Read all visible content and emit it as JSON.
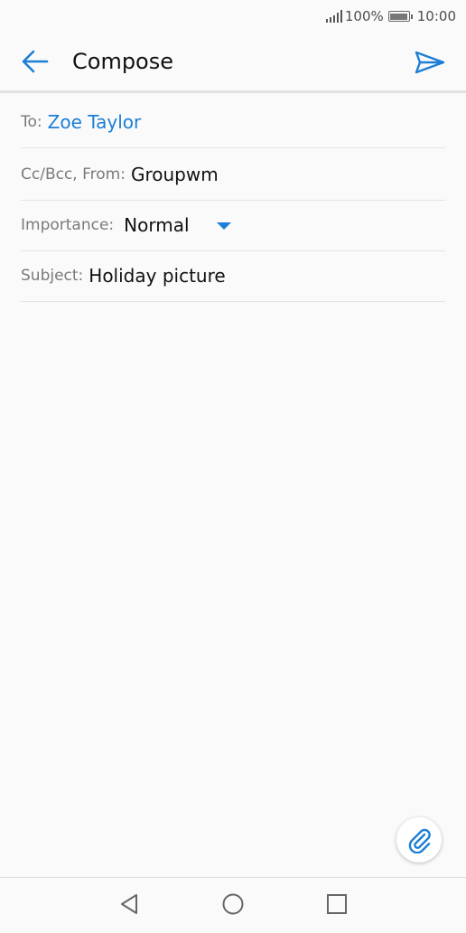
{
  "status_bar": {
    "battery_percent": "100%",
    "time": "10:00",
    "icons": [
      "signal-icon",
      "battery-icon"
    ]
  },
  "app_bar": {
    "title": "Compose",
    "back_icon": "arrow-left-icon",
    "send_icon": "send-icon"
  },
  "fields": {
    "to": {
      "label": "To:",
      "value": "Zoe Taylor"
    },
    "ccbcc_from": {
      "label": "Cc/Bcc, From:",
      "value": "Groupwm"
    },
    "importance": {
      "label": "Importance:",
      "value": "Normal"
    },
    "subject": {
      "label": "Subject:",
      "value": "Holiday picture"
    }
  },
  "body": {
    "text": ""
  },
  "fab": {
    "icon": "paperclip-icon"
  },
  "nav_bar": {
    "icons": [
      "back-triangle-icon",
      "home-circle-icon",
      "recents-square-icon"
    ]
  },
  "colors": {
    "accent": "#1c7ed6",
    "background": "#fafafa",
    "divider": "#e4e4e4"
  }
}
